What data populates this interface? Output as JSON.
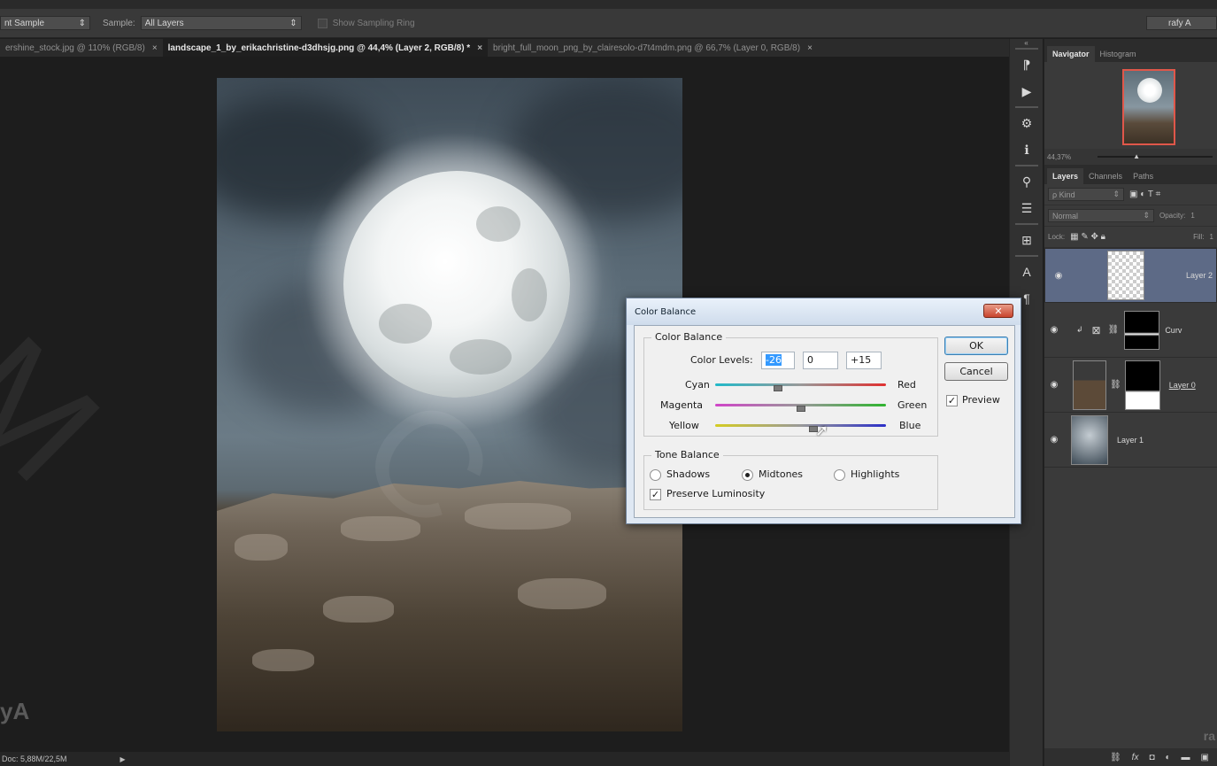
{
  "options_bar": {
    "sample_size_value": "nt Sample",
    "sample_label": "Sample:",
    "sample_value": "All Layers",
    "show_sampling_ring": "Show Sampling Ring",
    "user_name": "rafy A"
  },
  "tabs": [
    {
      "label": "ershine_stock.jpg @ 110% (RGB/8)",
      "close": "×"
    },
    {
      "label": "landscape_1_by_erikachristine-d3dhsjg.png @ 44,4% (Layer 2, RGB/8) *",
      "close": "×"
    },
    {
      "label": "bright_full_moon_png_by_clairesolo-d7t4mdm.png @ 66,7% (Layer 0, RGB/8)",
      "close": "×"
    }
  ],
  "status": {
    "doc": "Doc: 5,88M/22,5M",
    "arrow": "▶"
  },
  "watermark": {
    "left": "yA",
    "right": "ra"
  },
  "navigator": {
    "tabs": [
      "Navigator",
      "Histogram"
    ],
    "zoom": "44,37%"
  },
  "layers_panel": {
    "tabs": [
      "Layers",
      "Channels",
      "Paths"
    ],
    "kind_placeholder": "ρ Kind",
    "blend_mode": "Normal",
    "opacity_label": "Opacity:",
    "opacity_value": "1",
    "lock_label": "Lock:",
    "fill_label": "Fill:",
    "fill_value": "1",
    "layers": [
      {
        "name": "Layer 2"
      },
      {
        "name": "Curv"
      },
      {
        "name": "Layer 0"
      },
      {
        "name": "Layer 1"
      }
    ]
  },
  "dialog": {
    "title": "Color Balance",
    "close_glyph": "✕",
    "group1_title": "Color Balance",
    "color_levels_label": "Color Levels:",
    "level1": "-26",
    "level2": "0",
    "level3": "+15",
    "sliders": [
      {
        "left": "Cyan",
        "right": "Red",
        "level": -26,
        "left_color": "#21b9c9",
        "right_color": "#e03030"
      },
      {
        "left": "Magenta",
        "right": "Green",
        "level": 0,
        "left_color": "#d044c8",
        "right_color": "#2fb42f"
      },
      {
        "left": "Yellow",
        "right": "Blue",
        "level": 15,
        "left_color": "#d4cc22",
        "right_color": "#2b2fc8"
      }
    ],
    "group2_title": "Tone Balance",
    "tone_shadows": "Shadows",
    "tone_midtones": "Midtones",
    "tone_highlights": "Highlights",
    "preserve_luminosity": "Preserve Luminosity",
    "ok": "OK",
    "cancel": "Cancel",
    "preview": "Preview",
    "check_glyph": "✓"
  }
}
